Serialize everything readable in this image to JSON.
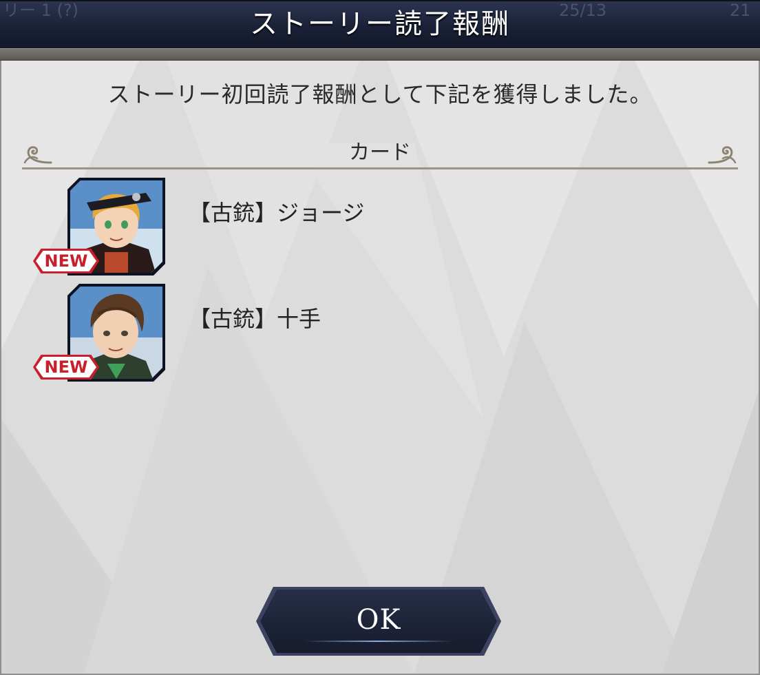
{
  "header": {
    "title": "ストーリー読了報酬",
    "background_text_left": "リー 1 (?)",
    "background_text_right_1": "25/13",
    "background_text_right_2": "21"
  },
  "dialog": {
    "message": "ストーリー初回読了報酬として下記を獲得しました。",
    "section_title": "カード",
    "cards": [
      {
        "name": "【古銃】ジョージ",
        "badge": "NEW",
        "portrait_icon": "blond-officer-portrait"
      },
      {
        "name": "【古銃】十手",
        "badge": "NEW",
        "portrait_icon": "brown-haired-man-portrait"
      }
    ],
    "ok_label": "OK"
  },
  "colors": {
    "header_bg": "#1b2238",
    "panel_bg": "#dcdcdc",
    "badge_red": "#c81f2a",
    "button_bg": "#1f2539"
  }
}
